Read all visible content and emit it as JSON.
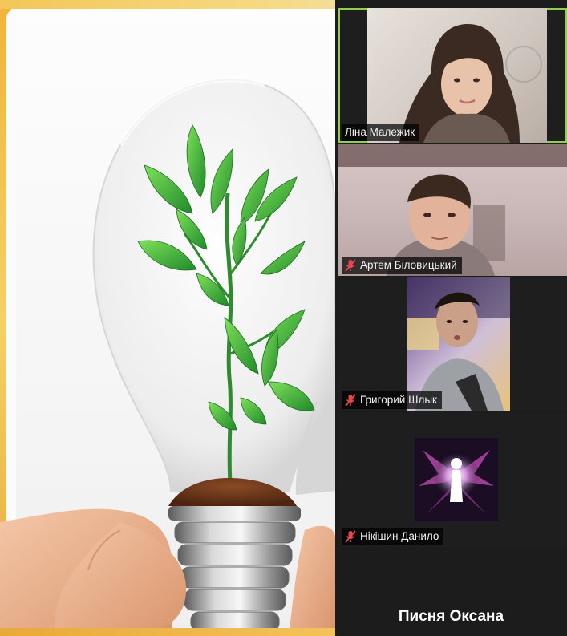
{
  "participants": [
    {
      "name": "Ліна Малежик",
      "muted": false,
      "active": true
    },
    {
      "name": "Артем Біловицький",
      "muted": true,
      "active": false
    },
    {
      "name": "Григорий Шлык",
      "muted": true,
      "active": false
    },
    {
      "name": "Нікішин Данило",
      "muted": true,
      "active": false
    }
  ],
  "no_video_participant": {
    "name": "Писня Оксана"
  },
  "colors": {
    "active_border": "#8fd14f",
    "muted_icon": "#e5484d",
    "panel_bg": "#1c1c1c",
    "slide_accent": "#f3c757"
  },
  "icons": {
    "muted": "mic-off-icon"
  }
}
